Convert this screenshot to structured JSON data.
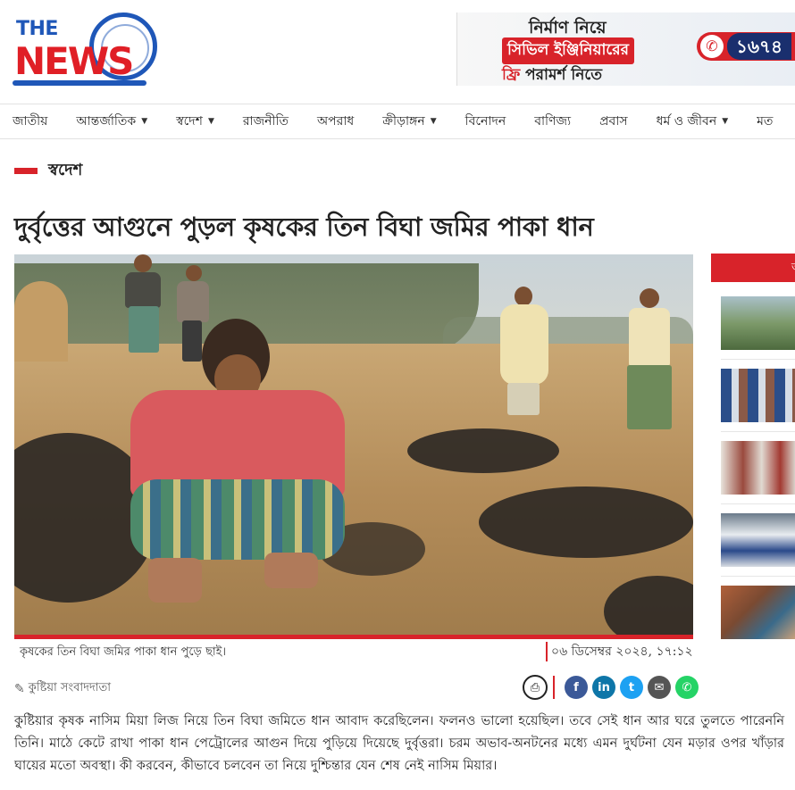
{
  "logo": {
    "the": "THE",
    "news": "NEWS"
  },
  "ad": {
    "line1": "নির্মাণ নিয়ে",
    "line2": "সিভিল ইঞ্জিনিয়ারের",
    "line3_red": "ফ্রি",
    "line3_rest": " পরামর্শ নিতে",
    "phone": "১৬৭৪"
  },
  "nav": {
    "items": [
      {
        "label": "জাতীয়",
        "dropdown": false
      },
      {
        "label": "আন্তর্জাতিক",
        "dropdown": true
      },
      {
        "label": "স্বদেশ",
        "dropdown": true
      },
      {
        "label": "রাজনীতি",
        "dropdown": false
      },
      {
        "label": "অপরাধ",
        "dropdown": false
      },
      {
        "label": "ক্রীড়াঙ্গন",
        "dropdown": true
      },
      {
        "label": "বিনোদন",
        "dropdown": false
      },
      {
        "label": "বাণিজ্য",
        "dropdown": false
      },
      {
        "label": "প্রবাস",
        "dropdown": false
      },
      {
        "label": "ধর্ম ও জীবন",
        "dropdown": true
      },
      {
        "label": "মত",
        "dropdown": false
      }
    ]
  },
  "section": "স্বদেশ",
  "article": {
    "headline": "দুর্বৃত্তের আগুনে পুড়ল কৃষকের তিন বিঘা জমির পাকা ধান",
    "photo_caption": "কৃষকের তিন বিঘা জমির পাকা ধান পুড়ে ছাই।",
    "date": "০৬ ডিসেম্বর ২০২৪, ১৭:১২",
    "byline": "কুষ্টিয়া সংবাদদাতা",
    "body": "কুষ্টিয়ার কৃষক নাসিম মিয়া লিজ নিয়ে তিন বিঘা জমিতে ধান আবাদ করেছিলেন। ফলনও ভালো হয়েছিল। তবে সেই ধান আর ঘরে তুলতে পারেননি তিনি। মাঠে কেটে রাখা পাকা ধান পেট্রোলের আগুন দিয়ে পুড়িয়ে দিয়েছে দুর্বৃত্তরা। চরম অভাব-অনটনের মধ্যে এমন দুর্ঘটনা যেন মড়ার ওপর খাঁড়ার ঘায়ের মতো অবস্থা। কী করবেন, কীভাবে চলবেন তা নিয়ে দুশ্চিন্তার যেন শেষ নেই নাসিম মিয়ার।"
  },
  "share": {
    "print_icon": "print-icon",
    "buttons": [
      {
        "name": "facebook",
        "glyph": "f",
        "color": "#3b5998"
      },
      {
        "name": "linkedin",
        "glyph": "in",
        "color": "#0e76a8"
      },
      {
        "name": "twitter",
        "glyph": "t",
        "color": "#1da1f2"
      },
      {
        "name": "email",
        "glyph": "✉",
        "color": "#555555"
      },
      {
        "name": "whatsapp",
        "glyph": "✆",
        "color": "#25d366"
      }
    ]
  },
  "sidebar": {
    "header": "অ"
  },
  "colors": {
    "accent": "#d8232a",
    "brand_blue": "#1f57b8"
  }
}
